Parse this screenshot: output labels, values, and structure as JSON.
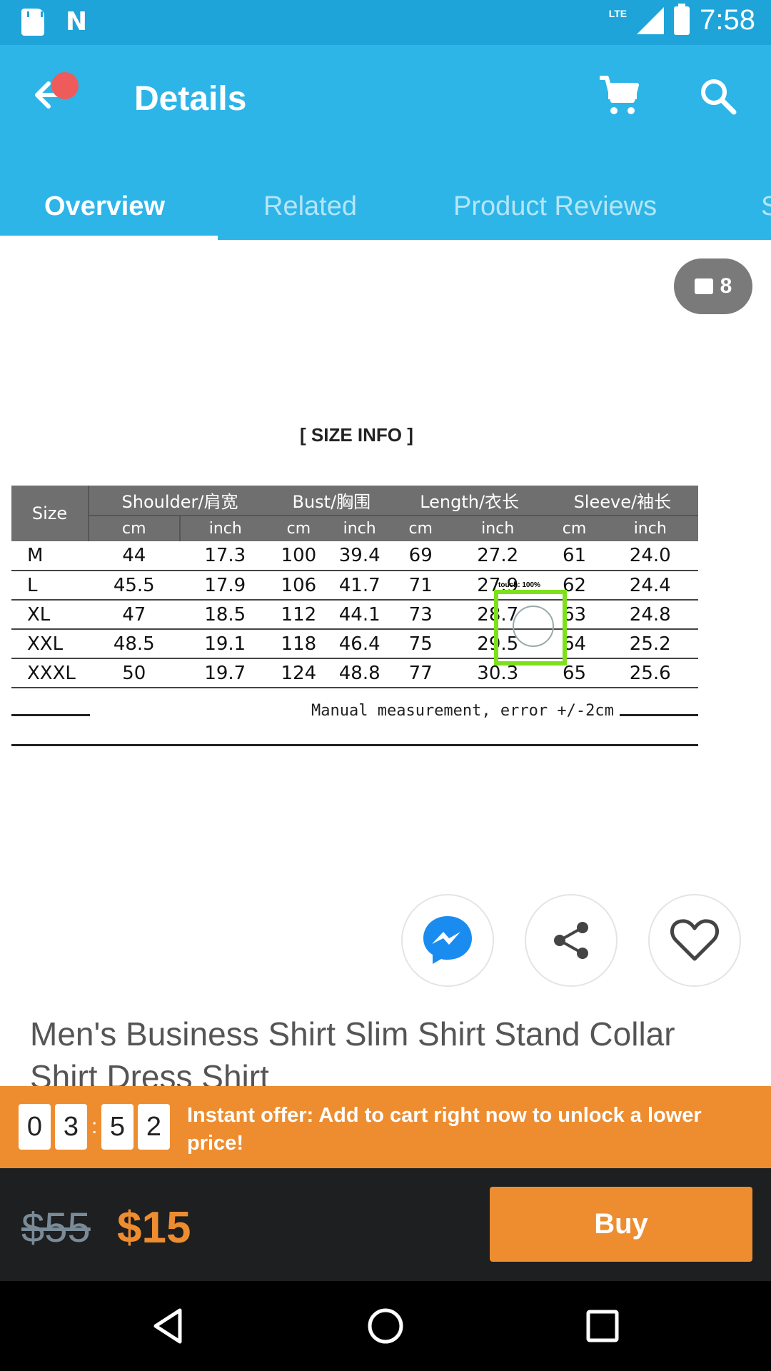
{
  "status_bar": {
    "network": "LTE",
    "time": "7:58",
    "n_logo": "N"
  },
  "app_bar": {
    "title": "Details"
  },
  "tabs": [
    {
      "label": "Overview"
    },
    {
      "label": "Related"
    },
    {
      "label": "Product Reviews"
    },
    {
      "label": "S"
    }
  ],
  "gallery": {
    "image_count": "8"
  },
  "size_info": {
    "title": "[ SIZE INFO ]",
    "headers": [
      "Size",
      "Shoulder/肩宽",
      "Bust/胸围",
      "Length/衣长",
      "Sleeve/袖长"
    ],
    "units": [
      "cm",
      "inch",
      "cm",
      "inch",
      "cm",
      "inch",
      "cm",
      "inch"
    ],
    "rows": [
      [
        "M",
        "44",
        "17.3",
        "100",
        "39.4",
        "69",
        "27.2",
        "61",
        "24.0"
      ],
      [
        "L",
        "45.5",
        "17.9",
        "106",
        "41.7",
        "71",
        "27.9",
        "62",
        "24.4"
      ],
      [
        "XL",
        "47",
        "18.5",
        "112",
        "44.1",
        "73",
        "28.7",
        "63",
        "24.8"
      ],
      [
        "XXL",
        "48.5",
        "19.1",
        "118",
        "46.4",
        "75",
        "29.5",
        "64",
        "25.2"
      ],
      [
        "XXXL",
        "50",
        "19.7",
        "124",
        "48.8",
        "77",
        "30.3",
        "65",
        "25.6"
      ]
    ],
    "note": "Manual measurement, error +/-2cm",
    "touch_label": "touch: 100%"
  },
  "product": {
    "title": "Men's Business Shirt Slim Shirt Stand Collar Shirt Dress Shirt"
  },
  "offer": {
    "timer_digits": [
      "0",
      "3",
      "5",
      "2"
    ],
    "separator": ":",
    "text": "Instant offer: Add to cart right now to unlock a lower price!"
  },
  "pricing": {
    "old_price": "$55",
    "new_price": "$15",
    "buy_label": "Buy"
  },
  "colors": {
    "app_bar": "#2db5e8",
    "status_bar": "#1ea4d9",
    "accent": "#ee8d2f",
    "bottom_bar": "#1d1f21",
    "messenger": "#1a8cf0"
  },
  "icons": [
    "sd-card-icon",
    "n-logo-icon",
    "signal-icon",
    "battery-icon",
    "back-arrow-icon",
    "cart-icon",
    "search-icon",
    "image-icon",
    "messenger-icon",
    "share-icon",
    "heart-icon",
    "nav-back-icon",
    "nav-home-icon",
    "nav-recents-icon"
  ]
}
